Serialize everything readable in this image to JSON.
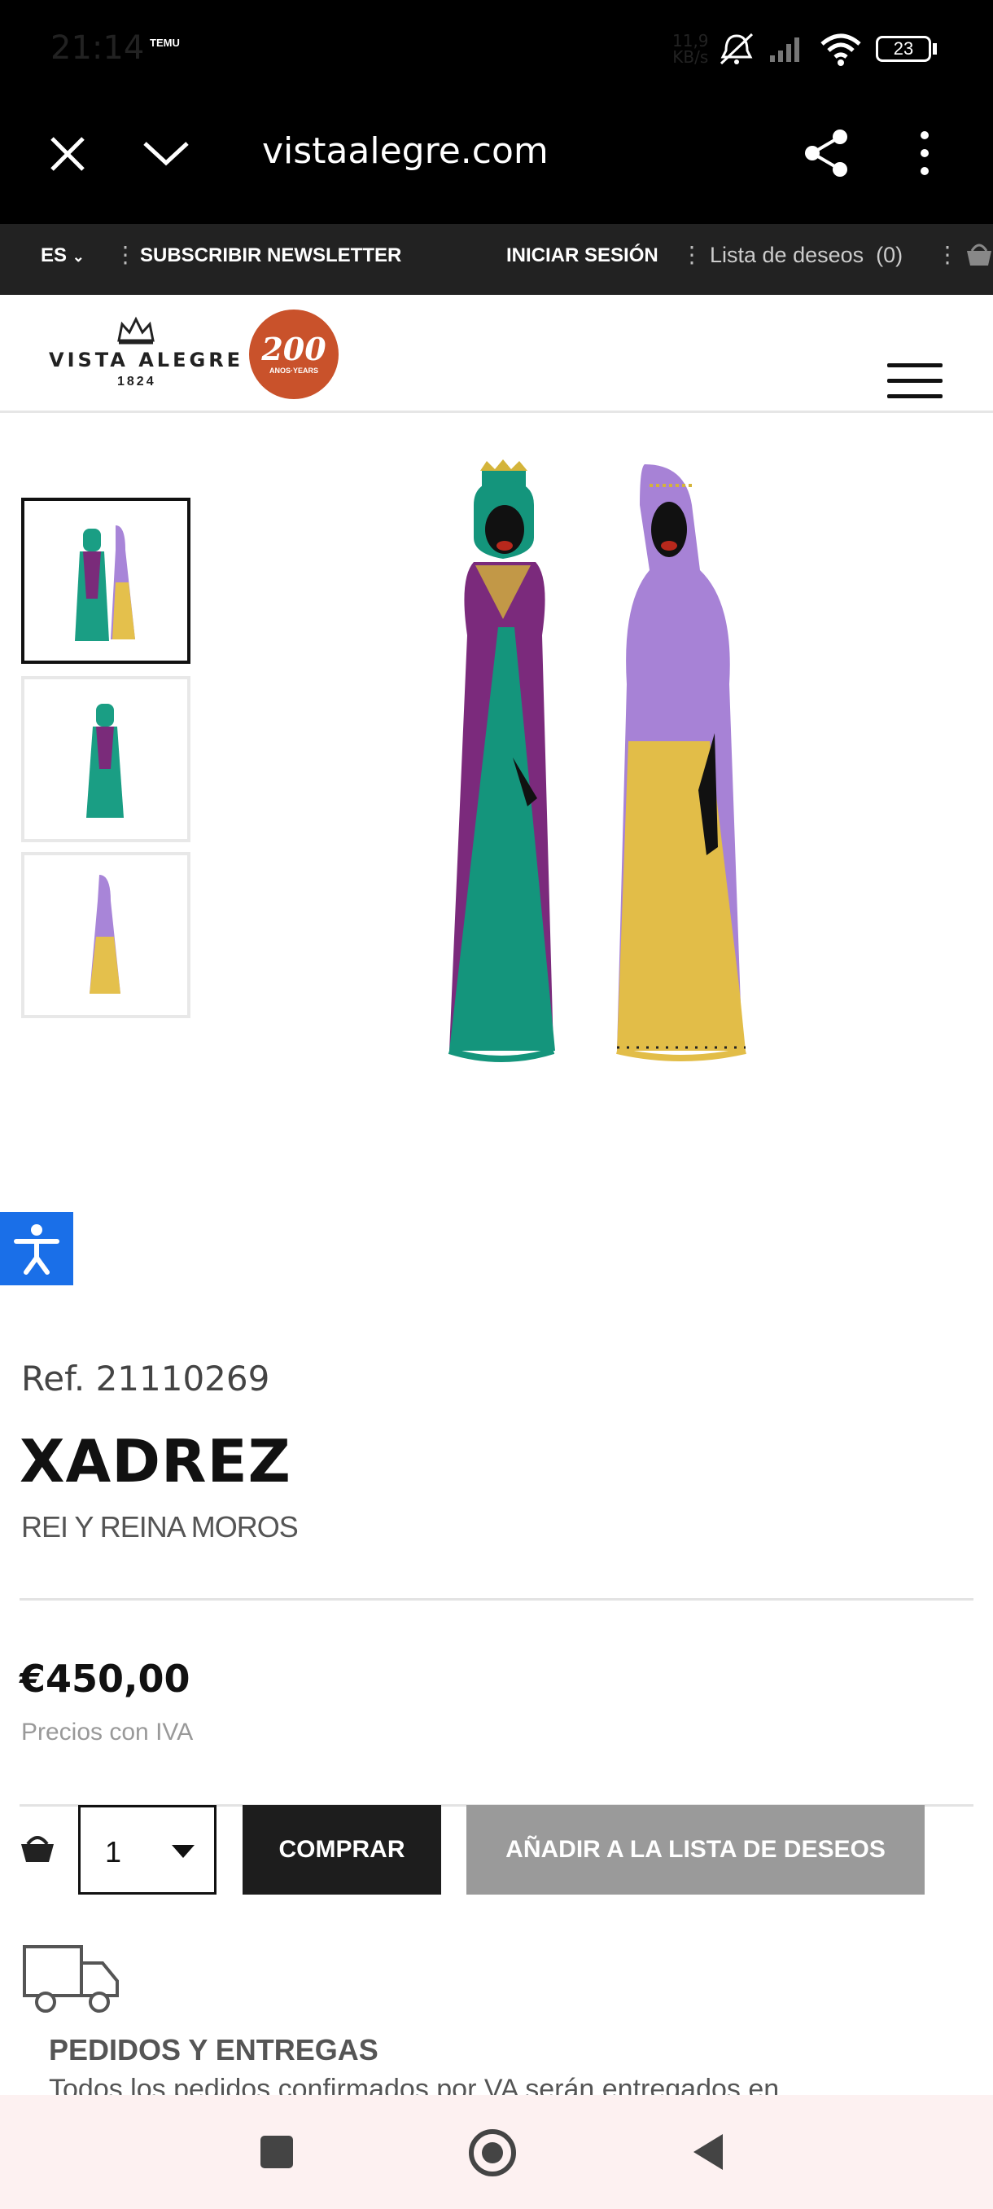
{
  "status_bar": {
    "time": "21:14",
    "notification_badge": "TEMU",
    "net_speed_value": "11,9",
    "net_speed_unit": "KB/s",
    "battery": "23"
  },
  "browser": {
    "url": "vistaalegre.com"
  },
  "top_strip": {
    "language": "ES",
    "newsletter": "SUBSCRIBIR NEWSLETTER",
    "login": "INICIAR SESIÓN",
    "wishlist": "Lista de deseos",
    "wishlist_count": "(0)"
  },
  "header": {
    "brand": "VISTA ALEGRE",
    "brand_year": "1824",
    "anniversary_number": "200",
    "anniversary_sub": "ANOS·YEARS"
  },
  "gallery": {
    "thumbnails": [
      {
        "alt": "thumbnail-both"
      },
      {
        "alt": "thumbnail-king"
      },
      {
        "alt": "thumbnail-queen"
      }
    ],
    "selected_index": 0
  },
  "product": {
    "ref": "Ref. 21110269",
    "title": "XADREZ",
    "subtitle": "REI Y REINA MOROS",
    "price": "€450,00",
    "vat_note": "Precios con IVA",
    "quantity": "1",
    "buy_label": "COMPRAR",
    "wishlist_label": "AÑADIR A LA LISTA DE DESEOS"
  },
  "delivery": {
    "title": "PEDIDOS Y ENTREGAS",
    "text": "Todos los pedidos confirmados por VA serán entregados en"
  },
  "colors": {
    "accent_dark": "#1d1d1d",
    "wishlist_gray": "#9a9a9a",
    "anniversary": "#c9522b",
    "accessibility_blue": "#1a6fe8"
  }
}
